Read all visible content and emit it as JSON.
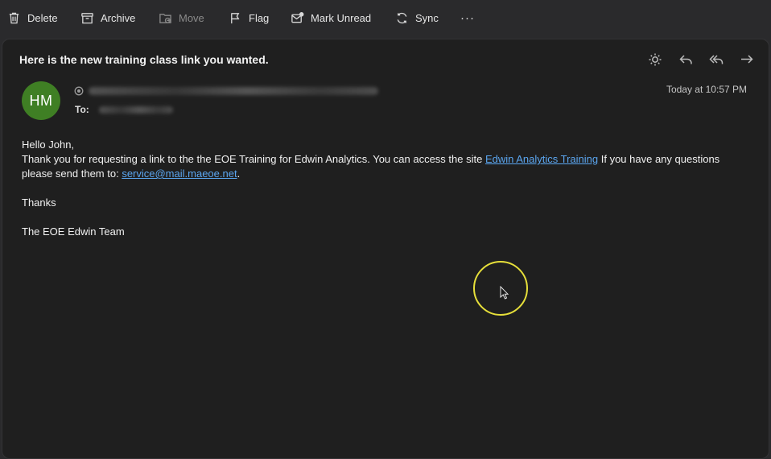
{
  "toolbar": {
    "delete_label": "Delete",
    "archive_label": "Archive",
    "move_label": "Move",
    "flag_label": "Flag",
    "mark_unread_label": "Mark Unread",
    "sync_label": "Sync",
    "more_label": "···"
  },
  "message": {
    "subject": "Here is the new training class link you wanted.",
    "avatar_initials": "HM",
    "avatar_color": "#3f7f24",
    "to_label": "To:",
    "timestamp": "Today at 10:57 PM",
    "greeting": "Hello John,",
    "line1_pre": "Thank you for requesting a link to the the EOE Training for Edwin Analytics. You can access the site ",
    "link_training": "Edwin Analytics Training",
    "line1_post": " If you have any questions",
    "line2_pre": "please send them to: ",
    "link_email": "service@mail.maeoe.net",
    "line2_post": ".",
    "thanks": "Thanks",
    "signature": "The EOE Edwin Team"
  },
  "icons": {
    "delete": "trash-icon",
    "archive": "archive-icon",
    "move": "folder-move-icon",
    "flag": "flag-icon",
    "mark_unread": "envelope-icon",
    "sync": "sync-icon",
    "summary": "sun-icon",
    "reply": "reply-icon",
    "reply_all": "reply-all-icon",
    "forward": "forward-icon"
  },
  "colors": {
    "link": "#5ba6f0",
    "cursor_highlight": "#e6df3a"
  }
}
